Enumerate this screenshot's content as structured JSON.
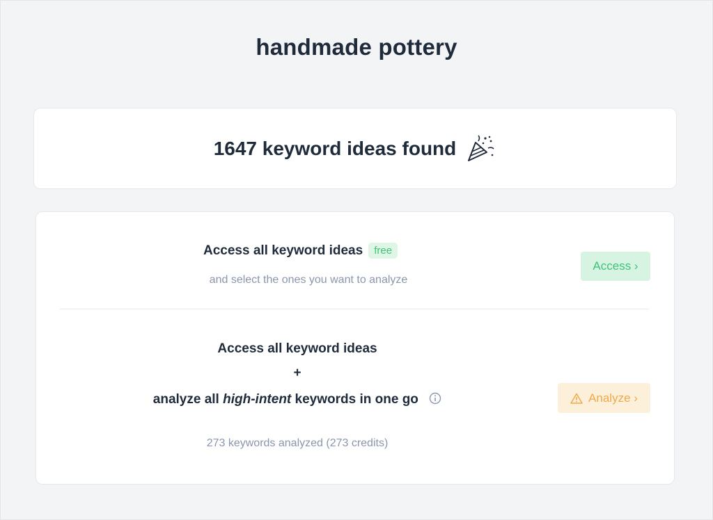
{
  "query": "handmade pottery",
  "result": {
    "text": "1647 keyword ideas found",
    "icon": "party-popper-icon"
  },
  "option_free": {
    "title": "Access all keyword ideas",
    "badge": "free",
    "subtitle": "and select the ones you want to analyze",
    "button_label": "Access ›",
    "accent_color": "#3fc17a"
  },
  "option_analyze": {
    "line1": "Access all keyword ideas",
    "plus": "+",
    "line3_prefix": "analyze all ",
    "line3_emphasis": "high-intent",
    "line3_suffix": " keywords in one go",
    "info_icon": "info-icon",
    "subtitle": "273 keywords analyzed (273 credits)",
    "button_label": "Analyze ›",
    "button_icon": "warning-icon",
    "accent_color": "#f0a94a"
  }
}
